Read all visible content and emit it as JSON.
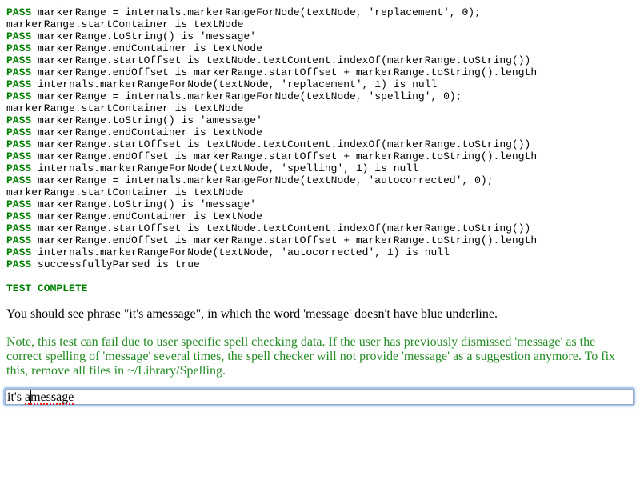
{
  "log": {
    "pass_label": "PASS",
    "lines": [
      {
        "pass": true,
        "text": " markerRange = internals.markerRangeForNode(textNode, 'replacement', 0);"
      },
      {
        "pass": false,
        "text": "markerRange.startContainer is textNode"
      },
      {
        "pass": true,
        "text": " markerRange.toString() is 'message'"
      },
      {
        "pass": true,
        "text": " markerRange.endContainer is textNode"
      },
      {
        "pass": true,
        "text": " markerRange.startOffset is textNode.textContent.indexOf(markerRange.toString())"
      },
      {
        "pass": true,
        "text": " markerRange.endOffset is markerRange.startOffset + markerRange.toString().length"
      },
      {
        "pass": true,
        "text": " internals.markerRangeForNode(textNode, 'replacement', 1) is null"
      },
      {
        "pass": true,
        "text": " markerRange = internals.markerRangeForNode(textNode, 'spelling', 0);"
      },
      {
        "pass": false,
        "text": "markerRange.startContainer is textNode"
      },
      {
        "pass": true,
        "text": " markerRange.toString() is 'amessage'"
      },
      {
        "pass": true,
        "text": " markerRange.endContainer is textNode"
      },
      {
        "pass": true,
        "text": " markerRange.startOffset is textNode.textContent.indexOf(markerRange.toString())"
      },
      {
        "pass": true,
        "text": " markerRange.endOffset is markerRange.startOffset + markerRange.toString().length"
      },
      {
        "pass": true,
        "text": " internals.markerRangeForNode(textNode, 'spelling', 1) is null"
      },
      {
        "pass": true,
        "text": " markerRange = internals.markerRangeForNode(textNode, 'autocorrected', 0);"
      },
      {
        "pass": false,
        "text": "markerRange.startContainer is textNode"
      },
      {
        "pass": true,
        "text": " markerRange.toString() is 'message'"
      },
      {
        "pass": true,
        "text": " markerRange.endContainer is textNode"
      },
      {
        "pass": true,
        "text": " markerRange.startOffset is textNode.textContent.indexOf(markerRange.toString())"
      },
      {
        "pass": true,
        "text": " markerRange.endOffset is markerRange.startOffset + markerRange.toString().length"
      },
      {
        "pass": true,
        "text": " internals.markerRangeForNode(textNode, 'autocorrected', 1) is null"
      },
      {
        "pass": true,
        "text": " successfullyParsed is true"
      }
    ],
    "complete": "TEST COMPLETE"
  },
  "instruction": "You should see phrase \"it's amessage\", in which the word 'message' doesn't have blue underline.",
  "note": "Note, this test can fail due to user specific spell checking data. If the user has previously dismissed 'message' as the correct spelling of 'message' several times, the spell checker will not provide 'message' as a suggestion anymore. To fix this, remove all files in ~/Library/Spelling.",
  "editor": {
    "prefix": "it's ",
    "misspelled_before_caret": "a",
    "misspelled_after_caret": "message"
  },
  "colors": {
    "pass": "#008000",
    "note": "#228b22",
    "misspelling_underline": "#e0201b",
    "focus_ring": "#a8c8f0"
  }
}
